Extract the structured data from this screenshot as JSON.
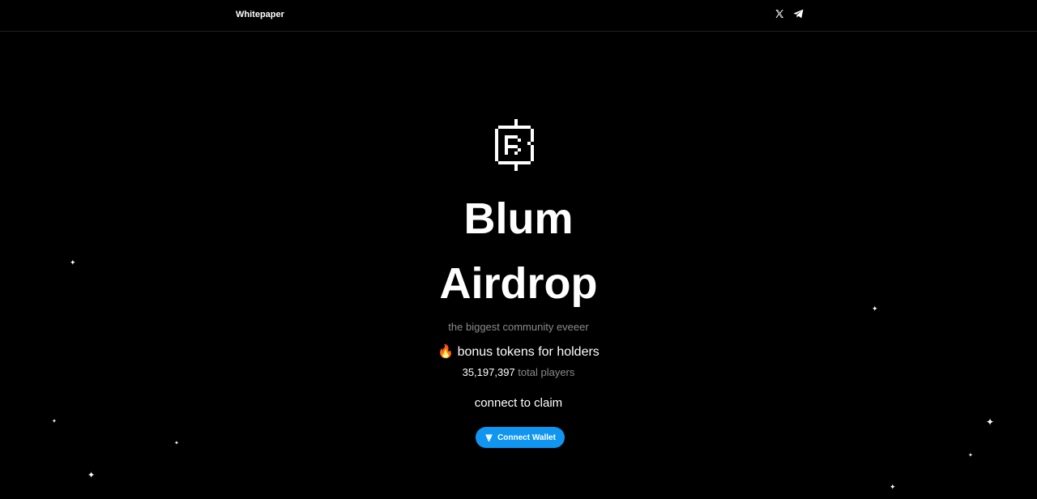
{
  "header": {
    "nav_link": "Whitepaper",
    "socials": [
      "x-icon",
      "telegram-icon"
    ]
  },
  "hero": {
    "logo": "blum-logo-icon",
    "title_line1": "Blum",
    "title_line2": "Airdrop",
    "subtitle": "the biggest community eveeer",
    "bonus_icon": "🔥",
    "bonus_text": "bonus tokens for holders",
    "players_count": "35,197,397",
    "players_label": "total players",
    "claim_text": "connect to claim",
    "connect_button": {
      "icon": "ton-icon",
      "label": "Connect Wallet",
      "color": "#1096f1"
    }
  },
  "decoration": {
    "star_glyph": "✦"
  }
}
